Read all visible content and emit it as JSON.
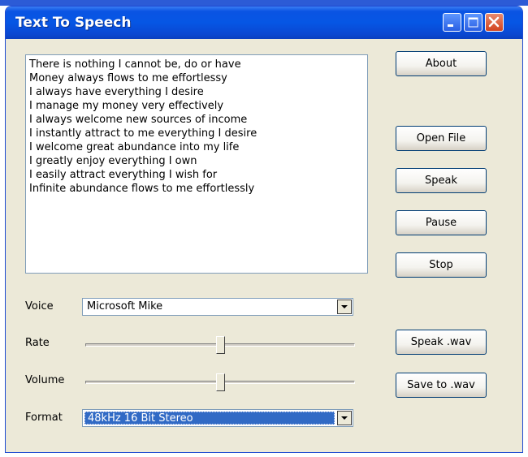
{
  "window": {
    "title": "Text To Speech"
  },
  "text_lines": [
    "There is nothing I cannot be, do or have",
    "Money always flows to me effortlessy",
    "I always have everything I desire",
    "I manage my money very effectively",
    "I always welcome new sources of income",
    "I instantly attract to me everything I desire",
    "I welcome great abundance into my life",
    "I greatly enjoy everything I own",
    "I easily attract everything I wish for",
    "Infinite abundance flows to me effortlessly"
  ],
  "buttons": {
    "about": "About",
    "open_file": "Open File",
    "speak": "Speak",
    "pause": "Pause",
    "stop": "Stop",
    "speak_wav": "Speak .wav",
    "save_wav": "Save to .wav"
  },
  "controls": {
    "voice_label": "Voice",
    "voice_value": "Microsoft Mike",
    "rate_label": "Rate",
    "rate_level": 0.5,
    "volume_label": "Volume",
    "volume_level": 0.5,
    "format_label": "Format",
    "format_value": "48kHz 16 Bit Stereo"
  },
  "icons": {
    "minimize": "minimize-icon",
    "maximize": "maximize-icon",
    "close": "close-icon",
    "dropdown": "chevron-down-icon"
  },
  "colors": {
    "titlebar": "#0656e4",
    "window_bg": "#ece9d8",
    "selection": "#316ac5",
    "close_button": "#d2431e"
  }
}
